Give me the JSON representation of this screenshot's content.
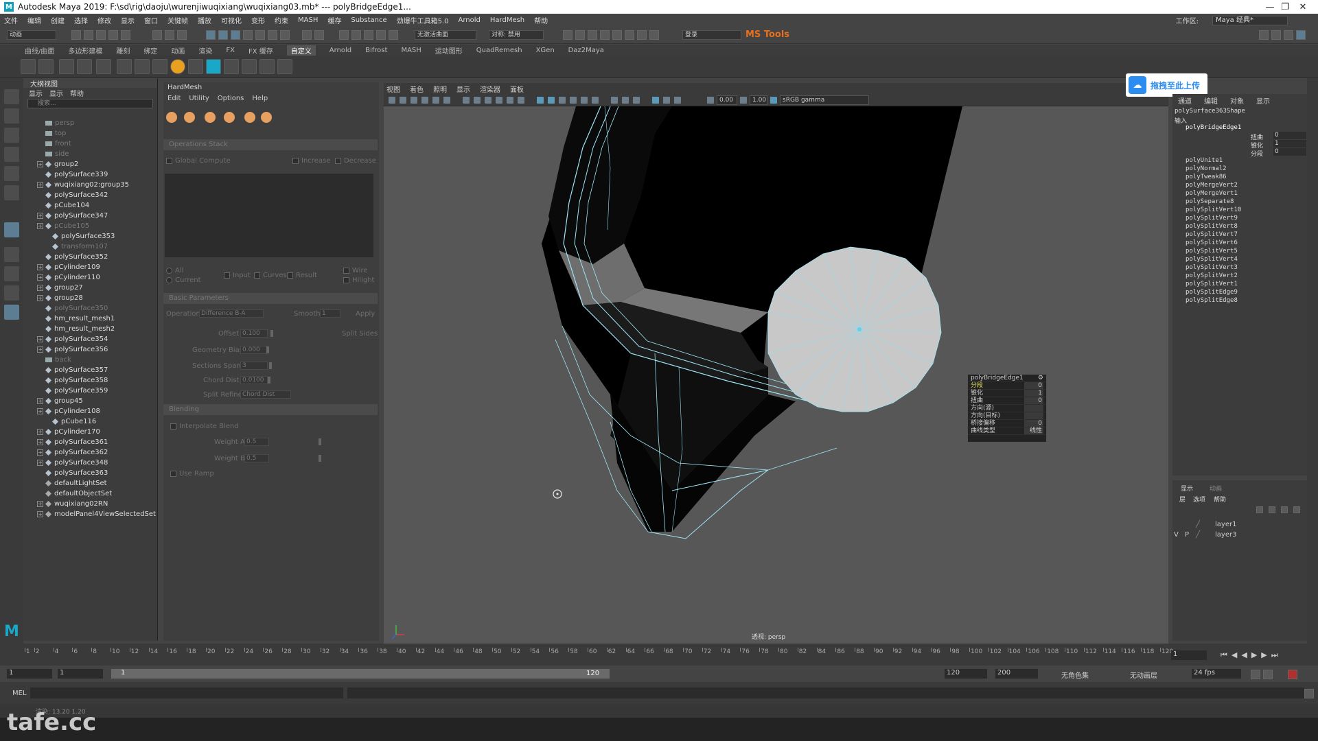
{
  "title_bar": {
    "app_title": "Autodesk Maya 2019: F:\\sd\\rig\\daoju\\wurenjiwuqixiang\\wuqixiang03.mb*   ---   polyBridgeEdge1...",
    "minimize": "—",
    "restore": "❐",
    "close": "✕"
  },
  "menu": [
    "文件",
    "编辑",
    "创建",
    "选择",
    "修改",
    "显示",
    "窗口",
    "关键帧",
    "播放",
    "可视化",
    "变形",
    "约束",
    "MASH",
    "缓存",
    "Substance",
    "劲爆牛工具箱5.0",
    "Arnold",
    "HardMesh",
    "帮助"
  ],
  "workspace": {
    "label": "工作区:",
    "value": "Maya 经典*"
  },
  "status_line": {
    "mode": "动画",
    "no_live": "无激活曲面",
    "symmetry": "对称: 禁用",
    "login": "登录",
    "ms_tools": "MS Tools"
  },
  "shelf_tabs": [
    "曲线/曲面",
    "多边形建模",
    "雕刻",
    "绑定",
    "动画",
    "渲染",
    "FX",
    "FX 缓存",
    "自定义",
    "Arnold",
    "Bifrost",
    "MASH",
    "运动图形",
    "QuadRemesh",
    "XGen",
    "Daz2Maya"
  ],
  "shelf_active": "自定义",
  "outliner": {
    "header": "大纲视图",
    "menus": [
      "显示",
      "显示",
      "帮助"
    ],
    "search_placeholder": "搜索...",
    "items": [
      {
        "name": "persp",
        "dim": true,
        "type": "cam",
        "expand": false,
        "indent": 0
      },
      {
        "name": "top",
        "dim": true,
        "type": "cam",
        "expand": false,
        "indent": 0
      },
      {
        "name": "front",
        "dim": true,
        "type": "cam",
        "expand": false,
        "indent": 0
      },
      {
        "name": "side",
        "dim": true,
        "type": "cam",
        "expand": false,
        "indent": 0
      },
      {
        "name": "group2",
        "dim": false,
        "type": "grp",
        "expand": true,
        "indent": 0
      },
      {
        "name": "polySurface339",
        "dim": false,
        "type": "mesh",
        "expand": false,
        "indent": 0
      },
      {
        "name": "wuqixiang02:group35",
        "dim": false,
        "type": "grp",
        "expand": true,
        "indent": 0
      },
      {
        "name": "polySurface342",
        "dim": false,
        "type": "mesh",
        "expand": false,
        "indent": 0
      },
      {
        "name": "pCube104",
        "dim": false,
        "type": "mesh",
        "expand": false,
        "indent": 0
      },
      {
        "name": "polySurface347",
        "dim": false,
        "type": "grp",
        "expand": true,
        "indent": 0
      },
      {
        "name": "pCube105",
        "dim": true,
        "type": "grp",
        "expand": true,
        "indent": 0
      },
      {
        "name": "polySurface353",
        "dim": false,
        "type": "mesh",
        "expand": false,
        "indent": 1
      },
      {
        "name": "transform107",
        "dim": true,
        "type": "grp",
        "expand": false,
        "indent": 1
      },
      {
        "name": "polySurface352",
        "dim": false,
        "type": "mesh",
        "expand": false,
        "indent": 0
      },
      {
        "name": "pCylinder109",
        "dim": false,
        "type": "grp",
        "expand": true,
        "indent": 0
      },
      {
        "name": "pCylinder110",
        "dim": false,
        "type": "grp",
        "expand": true,
        "indent": 0
      },
      {
        "name": "group27",
        "dim": false,
        "type": "grp",
        "expand": true,
        "indent": 0
      },
      {
        "name": "group28",
        "dim": false,
        "type": "grp",
        "expand": true,
        "indent": 0
      },
      {
        "name": "polySurface350",
        "dim": true,
        "type": "mesh",
        "expand": false,
        "indent": 0
      },
      {
        "name": "hm_result_mesh1",
        "dim": false,
        "type": "grp",
        "expand": false,
        "indent": 0
      },
      {
        "name": "hm_result_mesh2",
        "dim": false,
        "type": "grp",
        "expand": false,
        "indent": 0
      },
      {
        "name": "polySurface354",
        "dim": false,
        "type": "grp",
        "expand": true,
        "indent": 0
      },
      {
        "name": "polySurface356",
        "dim": false,
        "type": "grp",
        "expand": true,
        "indent": 0
      },
      {
        "name": "back",
        "dim": true,
        "type": "cam",
        "expand": false,
        "indent": 0
      },
      {
        "name": "polySurface357",
        "dim": false,
        "type": "mesh",
        "expand": false,
        "indent": 0
      },
      {
        "name": "polySurface358",
        "dim": false,
        "type": "mesh",
        "expand": false,
        "indent": 0
      },
      {
        "name": "polySurface359",
        "dim": false,
        "type": "mesh",
        "expand": false,
        "indent": 0
      },
      {
        "name": "group45",
        "dim": false,
        "type": "grp",
        "expand": true,
        "indent": 0
      },
      {
        "name": "pCylinder108",
        "dim": false,
        "type": "grp",
        "expand": true,
        "indent": 0
      },
      {
        "name": "pCube116",
        "dim": false,
        "type": "mesh",
        "expand": false,
        "indent": 1
      },
      {
        "name": "pCylinder170",
        "dim": false,
        "type": "grp",
        "expand": true,
        "indent": 0
      },
      {
        "name": "polySurface361",
        "dim": false,
        "type": "grp",
        "expand": true,
        "indent": 0
      },
      {
        "name": "polySurface362",
        "dim": false,
        "type": "grp",
        "expand": true,
        "indent": 0
      },
      {
        "name": "polySurface348",
        "dim": false,
        "type": "grp",
        "expand": true,
        "indent": 0
      },
      {
        "name": "polySurface363",
        "dim": false,
        "type": "mesh",
        "expand": false,
        "indent": 0
      },
      {
        "name": "defaultLightSet",
        "dim": false,
        "type": "set",
        "expand": false,
        "indent": 0
      },
      {
        "name": "defaultObjectSet",
        "dim": false,
        "type": "set",
        "expand": false,
        "indent": 0
      },
      {
        "name": "wuqixiang02RN",
        "dim": false,
        "type": "set",
        "expand": true,
        "indent": 0
      },
      {
        "name": "modelPanel4ViewSelectedSet",
        "dim": false,
        "type": "set",
        "expand": true,
        "indent": 0
      }
    ]
  },
  "hardmesh": {
    "title": "HardMesh",
    "menus": [
      "Edit",
      "Utility",
      "Options",
      "Help"
    ],
    "operations_stack": "Operations Stack",
    "global_compute": "Global Compute",
    "increase": "Increase",
    "decrease": "Decrease",
    "all": "All",
    "current": "Current",
    "input": "Input",
    "curves": "Curves",
    "result": "Result",
    "wire": "Wire",
    "hilight": "Hilight",
    "basic_parameters": "Basic Parameters",
    "operation_label": "Operation",
    "operation_value": "Difference B-A",
    "smooth_label": "Smooth",
    "smooth_value": "1",
    "apply": "Apply",
    "offset_label": "Offset",
    "offset_value": "0.100",
    "split_sides": "Split Sides",
    "geometry_bias_label": "Geometry Bias",
    "geometry_bias_value": "0.000",
    "sections_spans_label": "Sections Spans",
    "sections_spans_value": "3",
    "chord_dist_label": "Chord Dist",
    "chord_dist_value": "0.0100",
    "split_refine_label": "Split Refine",
    "split_refine_value": "Chord Dist",
    "blending": "Blending",
    "interpolate_blend": "Interpolate Blend",
    "weight_a_label": "Weight A",
    "weight_a_value": "0.5",
    "weight_b_label": "Weight B",
    "weight_b_value": "0.5",
    "use_ramp": "Use Ramp"
  },
  "viewport": {
    "menus": [
      "视图",
      "着色",
      "照明",
      "显示",
      "渲染器",
      "面板"
    ],
    "near": "0.00",
    "far": "1.00",
    "color_space": "sRGB gamma",
    "camera_label": "透视: persp",
    "hud": {
      "title": "polyBridgeEdge1",
      "rows": [
        {
          "label": "分段",
          "value": "0"
        },
        {
          "label": "锥化",
          "value": "1"
        },
        {
          "label": "扭曲",
          "value": "0"
        },
        {
          "label": "方向(源)",
          "value": ""
        },
        {
          "label": "方向(目标)",
          "value": ""
        },
        {
          "label": "桥接偏移",
          "value": "0"
        },
        {
          "label": "曲线类型",
          "value": "线性"
        }
      ]
    }
  },
  "upload_button": "拖拽至此上传",
  "channel_box": {
    "tabs": [
      "通道",
      "编辑",
      "对象",
      "显示"
    ],
    "shape": "polySurface363Shape",
    "inputs_label": "输入",
    "active_node": "polyBridgeEdge1",
    "attrs": [
      {
        "label": "扭曲",
        "value": "0"
      },
      {
        "label": "锥化",
        "value": "1"
      },
      {
        "label": "分段",
        "value": "0"
      }
    ],
    "history": [
      "polyUnite1",
      "polyNormal2",
      "polyTweak86",
      "polyMergeVert2",
      "polyMergeVert1",
      "polySeparate8",
      "polySplitVert10",
      "polySplitVert9",
      "polySplitVert8",
      "polySplitVert7",
      "polySplitVert6",
      "polySplitVert5",
      "polySplitVert4",
      "polySplitVert3",
      "polySplitVert2",
      "polySplitVert1",
      "polySplitEdge9",
      "polySplitEdge8"
    ]
  },
  "layers": {
    "tabs": [
      "显示",
      "动画"
    ],
    "menus": [
      "层",
      "选项",
      "帮助"
    ],
    "items": [
      {
        "v": "",
        "p": "",
        "name": "layer1"
      },
      {
        "v": "V",
        "p": "P",
        "name": "layer3"
      }
    ]
  },
  "timeline": {
    "ticks": [
      "1",
      "2",
      "4",
      "6",
      "8",
      "10",
      "12",
      "14",
      "16",
      "18",
      "20",
      "22",
      "24",
      "26",
      "28",
      "30",
      "32",
      "34",
      "36",
      "38",
      "40",
      "42",
      "44",
      "46",
      "48",
      "50",
      "52",
      "54",
      "56",
      "58",
      "60",
      "62",
      "64",
      "66",
      "68",
      "70",
      "72",
      "74",
      "76",
      "78",
      "80",
      "82",
      "84",
      "86",
      "88",
      "90",
      "92",
      "94",
      "96",
      "98",
      "100",
      "102",
      "104",
      "106",
      "108",
      "110",
      "112",
      "114",
      "116",
      "118",
      "120"
    ],
    "current_frame": "1"
  },
  "range": {
    "start": "1",
    "start2": "1",
    "range_start": "1",
    "range_end": "120",
    "end": "120",
    "end2": "200",
    "char_set": "无角色集",
    "anim_layer": "无动画层",
    "fps": "24 fps"
  },
  "cmdline": {
    "label": "MEL"
  },
  "helpline": {
    "text": "渲染: 13.20   1.20"
  },
  "watermark": "tafe.cc"
}
